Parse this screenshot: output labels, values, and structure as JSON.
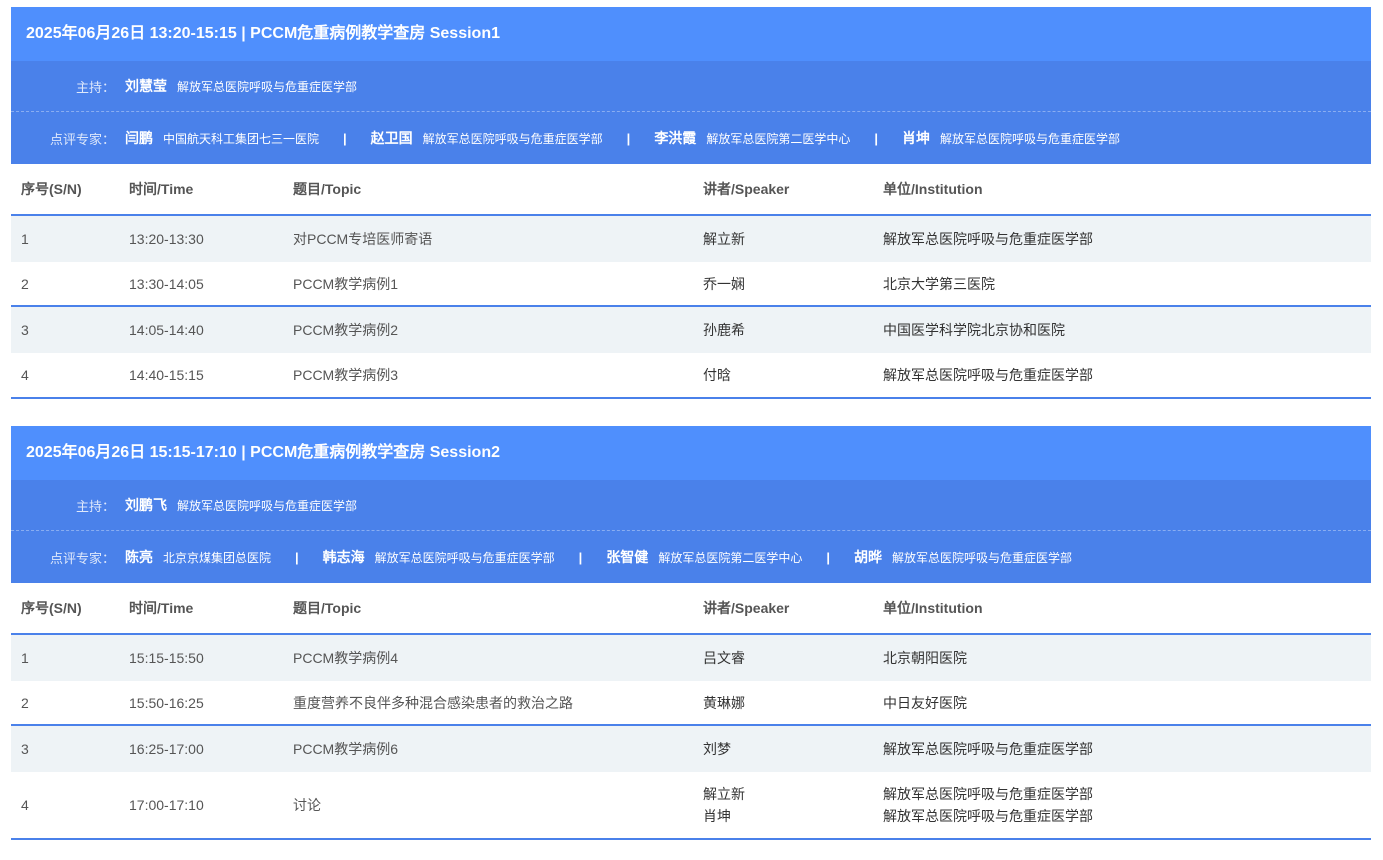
{
  "columns": {
    "sn": "序号(S/N)",
    "time": "时间/Time",
    "topic": "题目/Topic",
    "speaker": "讲者/Speaker",
    "institution": "单位/Institution"
  },
  "labels": {
    "host": "主持：",
    "reviewers": "点评专家：",
    "separator": "|"
  },
  "sessions": [
    {
      "title": "2025年06月26日 13:20-15:15 | PCCM危重病例教学查房 Session1",
      "host": {
        "name": "刘慧莹",
        "inst": "解放军总医院呼吸与危重症医学部"
      },
      "reviewers": [
        {
          "name": "闫鹏",
          "inst": "中国航天科工集团七三一医院"
        },
        {
          "name": "赵卫国",
          "inst": "解放军总医院呼吸与危重症医学部"
        },
        {
          "name": "李洪霞",
          "inst": "解放军总医院第二医学中心"
        },
        {
          "name": "肖坤",
          "inst": "解放军总医院呼吸与危重症医学部"
        }
      ],
      "rows": [
        {
          "sn": "1",
          "time": "13:20-13:30",
          "topic": "对PCCM专培医师寄语",
          "speaker": "解立新",
          "inst": "解放军总医院呼吸与危重症医学部"
        },
        {
          "sn": "2",
          "time": "13:30-14:05",
          "topic": "PCCM教学病例1",
          "speaker": "乔一娴",
          "inst": "北京大学第三医院"
        },
        {
          "sn": "3",
          "time": "14:05-14:40",
          "topic": "PCCM教学病例2",
          "speaker": "孙鹿希",
          "inst": "中国医学科学院北京协和医院"
        },
        {
          "sn": "4",
          "time": "14:40-15:15",
          "topic": "PCCM教学病例3",
          "speaker": "付晗",
          "inst": "解放军总医院呼吸与危重症医学部"
        }
      ]
    },
    {
      "title": "2025年06月26日 15:15-17:10 | PCCM危重病例教学查房 Session2",
      "host": {
        "name": "刘鹏飞",
        "inst": "解放军总医院呼吸与危重症医学部"
      },
      "reviewers": [
        {
          "name": "陈亮",
          "inst": "北京京煤集团总医院"
        },
        {
          "name": "韩志海",
          "inst": "解放军总医院呼吸与危重症医学部"
        },
        {
          "name": "张智健",
          "inst": "解放军总医院第二医学中心"
        },
        {
          "name": "胡晔",
          "inst": "解放军总医院呼吸与危重症医学部"
        }
      ],
      "rows": [
        {
          "sn": "1",
          "time": "15:15-15:50",
          "topic": "PCCM教学病例4",
          "speaker": "吕文睿",
          "inst": "北京朝阳医院"
        },
        {
          "sn": "2",
          "time": "15:50-16:25",
          "topic": "重度营养不良伴多种混合感染患者的救治之路",
          "speaker": "黄琳娜",
          "inst": "中日友好医院"
        },
        {
          "sn": "3",
          "time": "16:25-17:00",
          "topic": "PCCM教学病例6",
          "speaker": "刘梦",
          "inst": "解放军总医院呼吸与危重症医学部"
        },
        {
          "sn": "4",
          "time": "17:00-17:10",
          "topic": "讨论",
          "speaker": "解立新",
          "inst": "解放军总医院呼吸与危重症医学部",
          "speaker2": "肖坤",
          "inst2": "解放军总医院呼吸与危重症医学部"
        }
      ]
    }
  ]
}
